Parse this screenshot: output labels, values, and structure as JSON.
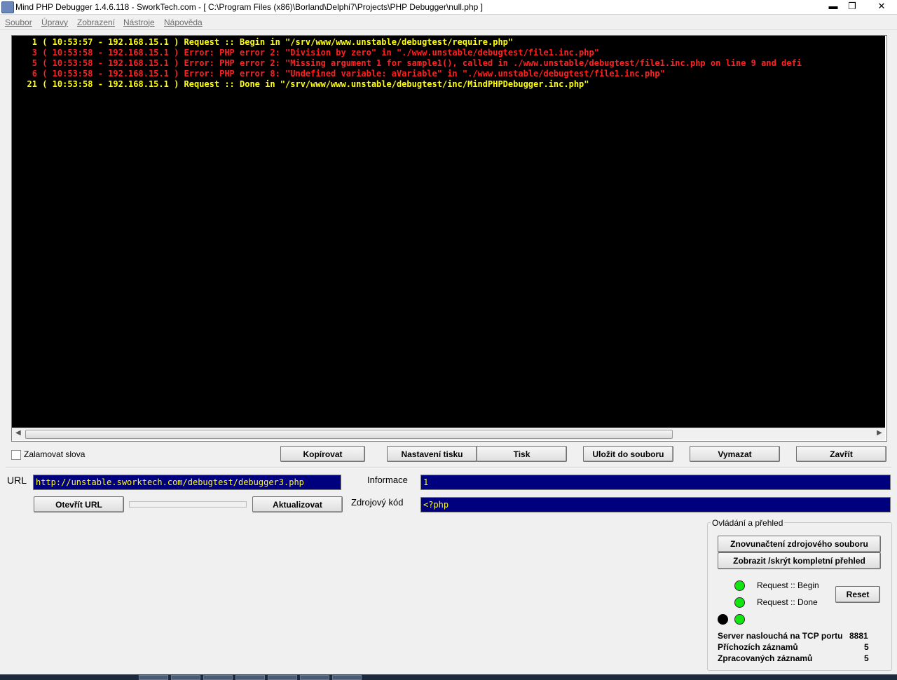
{
  "window": {
    "title": "Mind PHP Debugger 1.4.6.118 - SworkTech.com - [ C:\\Program Files (x86)\\Borland\\Delphi7\\Projects\\PHP Debugger\\null.php ]",
    "minimize": "▬",
    "maximize": "❐",
    "close": "✕"
  },
  "menu": [
    "Soubor",
    "Úpravy",
    "Zobrazení",
    "Nástroje",
    "Nápověda"
  ],
  "colors": {
    "log_background": "#000000",
    "request_color": "#ffff00",
    "error_color": "#ff2020",
    "field_background": "#00007f",
    "led_on": "#11e611"
  },
  "log": [
    {
      "num": "1",
      "text": "( 10:53:57 - 192.168.15.1 ) Request :: Begin in \"/srv/www/www.unstable/debugtest/require.php\"",
      "type": "request"
    },
    {
      "num": "3",
      "text": "( 10:53:58 - 192.168.15.1 ) Error: PHP error 2: \"Division by zero\" in \"./www.unstable/debugtest/file1.inc.php\"",
      "type": "error"
    },
    {
      "num": "5",
      "text": "( 10:53:58 - 192.168.15.1 ) Error: PHP error 2: \"Missing argument 1 for sample1(), called in ./www.unstable/debugtest/file1.inc.php on line 9 and defi",
      "type": "error"
    },
    {
      "num": "6",
      "text": "( 10:53:58 - 192.168.15.1 ) Error: PHP error 8: \"Undefined variable: aVariable\" in \"./www.unstable/debugtest/file1.inc.php\"",
      "type": "error"
    },
    {
      "num": "21",
      "text": "( 10:53:58 - 192.168.15.1 ) Request :: Done in \"/srv/www/www.unstable/debugtest/inc/MindPHPDebugger.inc.php\"",
      "type": "request"
    }
  ],
  "toolbar": {
    "wrap_label": "Zalamovat slova",
    "copy": "Kopírovat",
    "print_setup": "Nastavení tisku",
    "print": "Tisk",
    "save": "Uložit do souboru",
    "clear": "Vymazat",
    "close": "Zavřít"
  },
  "url": {
    "label": "URL",
    "value": "http://unstable.sworktech.com/debugtest/debugger3.php",
    "open_button": "Otevřít URL",
    "refresh_button": "Aktualizovat"
  },
  "info": {
    "label": "Informace",
    "value": "1"
  },
  "source": {
    "label": "Zdrojový kód",
    "value": "<?php"
  },
  "control": {
    "title": "Ovládání a přehled",
    "reload_button": "Znovunačtení zdrojového souboru",
    "toggle_button": "Zobrazit /skrýt kompletní přehled",
    "status_begin": "Request :: Begin",
    "status_done": "Request :: Done",
    "reset_button": "Reset",
    "port_label": "Server naslouchá na TCP portu",
    "port_value": "8881",
    "incoming_label": "Příchozích záznamů",
    "incoming_value": "5",
    "processed_label": "Zpracovaných záznamů",
    "processed_value": "5"
  }
}
